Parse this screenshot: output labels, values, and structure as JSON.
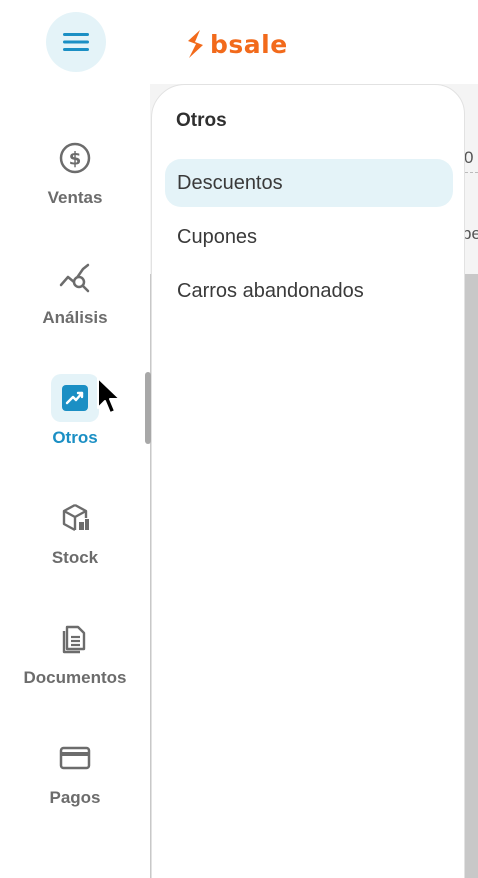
{
  "header": {
    "menu_icon": "hamburger-icon",
    "brand": "bsale",
    "brand_color": "#f26a1b"
  },
  "nav": {
    "accent_color": "#1b8fc4",
    "items": [
      {
        "label": "Ventas",
        "icon": "dollar-circle-icon"
      },
      {
        "label": "Análisis",
        "icon": "analytics-search-icon"
      },
      {
        "label": "Otros",
        "icon": "trending-up-icon",
        "active": true
      },
      {
        "label": "Stock",
        "icon": "box-icon"
      },
      {
        "label": "Documentos",
        "icon": "documents-icon"
      },
      {
        "label": "Pagos",
        "icon": "credit-card-icon"
      }
    ]
  },
  "flyout": {
    "title": "Otros",
    "items": [
      {
        "label": "Descuentos",
        "selected": true
      },
      {
        "label": "Cupones"
      },
      {
        "label": "Carros abandonados"
      }
    ]
  },
  "background": {
    "fragment_1": "0",
    "fragment_2": "be"
  }
}
